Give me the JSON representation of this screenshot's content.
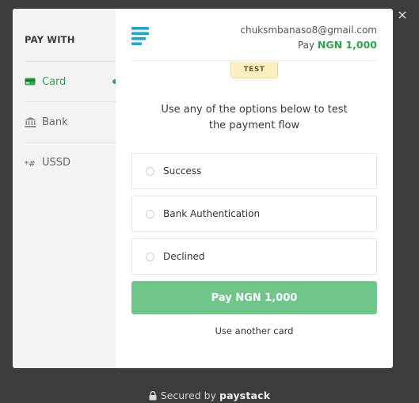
{
  "close": {
    "label": "×"
  },
  "sidebar": {
    "title": "PAY WITH",
    "items": [
      {
        "label": "Card",
        "icon": "card-icon",
        "active": true
      },
      {
        "label": "Bank",
        "icon": "bank-icon",
        "active": false
      },
      {
        "label": "USSD",
        "icon": "ussd-icon",
        "active": false
      }
    ]
  },
  "header": {
    "email": "chuksmbanaso8@gmail.com",
    "pay_prefix": "Pay",
    "amount": "NGN 1,000"
  },
  "badge": "TEST",
  "instruction": "Use any of the options below to test the payment flow",
  "options": [
    {
      "label": "Success"
    },
    {
      "label": "Bank Authentication"
    },
    {
      "label": "Declined"
    }
  ],
  "pay_button": "Pay NGN 1,000",
  "another_card": "Use another card",
  "footer": {
    "secured": "Secured by",
    "brand": "paystack"
  },
  "colors": {
    "accent": "#2aa84a",
    "button": "#6ec68a",
    "backdrop": "#3c3c3c",
    "logo": "#1aa6d6"
  }
}
